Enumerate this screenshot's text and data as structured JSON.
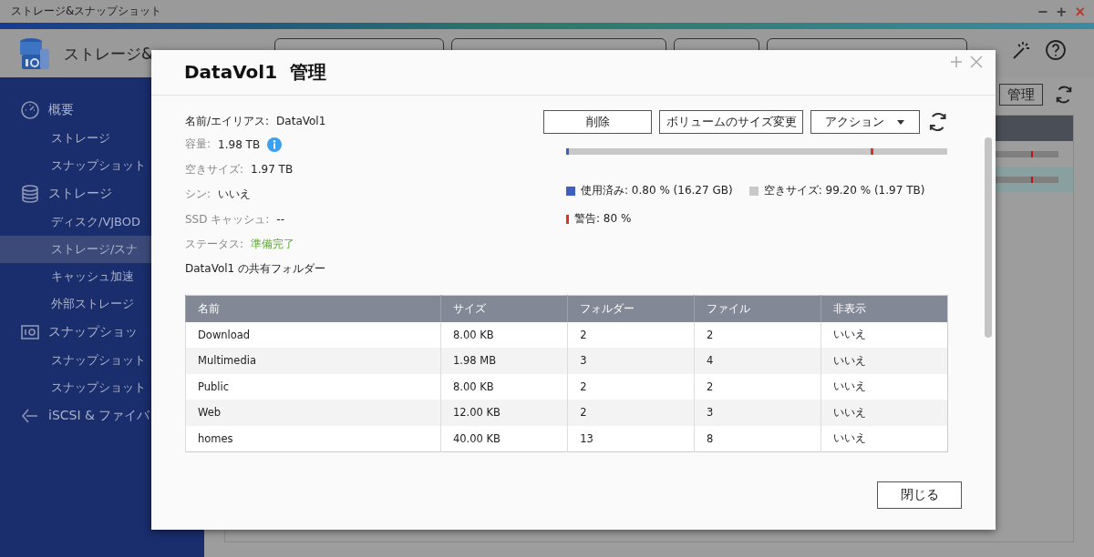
{
  "window": {
    "title": "ストレージ&スナップショット",
    "controls": [
      "−",
      "+",
      "×"
    ]
  },
  "toolbar": {
    "app_title": "ストレージ&",
    "menus": [
      {
        "kind": "menu"
      },
      {
        "kind": "menu"
      },
      {
        "kind": "menu"
      },
      {
        "kind": "menu"
      }
    ]
  },
  "sidebar": {
    "sections": [
      {
        "label": "概要",
        "kind": "overview",
        "children": [
          {
            "label": "ストレージ",
            "selected": false
          },
          {
            "label": "スナップショット",
            "selected": false
          }
        ]
      },
      {
        "label": "ストレージ",
        "kind": "storage",
        "children": [
          {
            "label": "ディスク/VJBOD",
            "selected": false
          },
          {
            "label": "ストレージ/スナ",
            "selected": true
          },
          {
            "label": "キャッシュ加速",
            "selected": false
          },
          {
            "label": "外部ストレージ",
            "selected": false
          }
        ]
      },
      {
        "label": "スナップショッ",
        "kind": "snapshot",
        "children": [
          {
            "label": "スナップショット",
            "selected": false
          },
          {
            "label": "スナップショット",
            "selected": false
          }
        ]
      },
      {
        "label": "iSCSI & ファイバ",
        "kind": "iscsi"
      }
    ]
  },
  "background": {
    "button": "管理"
  },
  "dialog": {
    "title": "DataVol1  管理",
    "info": [
      {
        "label": "名前/エイリアス:",
        "value": "DataVol1",
        "kind": "name"
      },
      {
        "label": "容量:",
        "value": "1.98 TB",
        "kind": "info"
      },
      {
        "label": "空きサイズ:",
        "value": "1.97 TB",
        "kind": "plain"
      },
      {
        "label": "シン:",
        "value": "いいえ",
        "kind": "plain"
      },
      {
        "label": "SSD キャッシュ:",
        "value": "--",
        "kind": "plain"
      },
      {
        "label": "ステータス:",
        "value": "準備完了",
        "kind": "status"
      }
    ],
    "folder_heading": "DataVol1 の共有フォルダー",
    "buttons": [
      {
        "label": "削除",
        "kind": "plain"
      },
      {
        "label": "ボリュームのサイズ変更",
        "kind": "plain"
      },
      {
        "label": "アクション",
        "kind": "dropdown"
      }
    ],
    "usage": {
      "used": {
        "level": 0.008
      },
      "warning": {
        "level": 0.8
      },
      "legend": [
        {
          "text": "使用済み: 0.80 % (16.27 GB)",
          "kind": "used"
        },
        {
          "text": "空きサイズ: 99.20 % (1.97 TB)",
          "kind": "free"
        },
        {
          "text": "警告: 80 %",
          "kind": "warning"
        }
      ]
    },
    "table": {
      "columns": [
        "名前",
        "サイズ",
        "フォルダー",
        "ファイル",
        "非表示"
      ],
      "rows": [
        [
          "Download",
          "8.00 KB",
          "2",
          "2",
          "いいえ"
        ],
        [
          "Multimedia",
          "1.98 MB",
          "3",
          "4",
          "いいえ"
        ],
        [
          "Public",
          "8.00 KB",
          "2",
          "2",
          "いいえ"
        ],
        [
          "Web",
          "12.00 KB",
          "2",
          "3",
          "いいえ"
        ],
        [
          "homes",
          "40.00 KB",
          "13",
          "8",
          "いいえ"
        ]
      ]
    },
    "close": "閉じる"
  }
}
